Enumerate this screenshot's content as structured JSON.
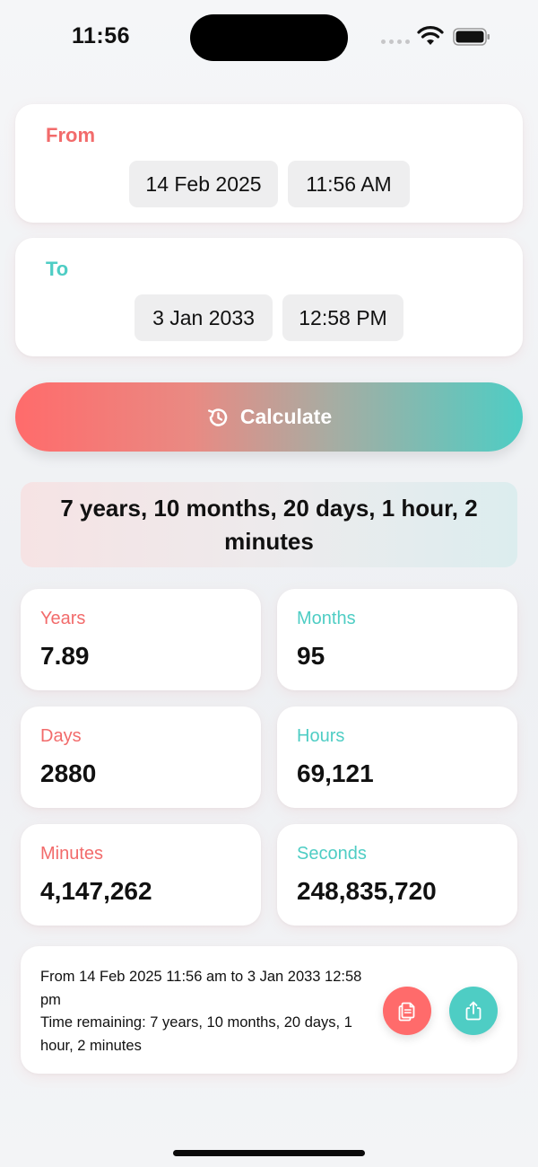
{
  "status_bar": {
    "time": "11:56"
  },
  "from": {
    "label": "From",
    "date": "14 Feb 2025",
    "time": "11:56 AM"
  },
  "to": {
    "label": "To",
    "date": "3 Jan 2033",
    "time": "12:58 PM"
  },
  "calculate_button": {
    "label": "Calculate",
    "icon": "history-icon"
  },
  "result": {
    "text": "7 years, 10 months, 20 days, 1 hour, 2 minutes"
  },
  "stats": [
    {
      "label": "Years",
      "value": "7.89"
    },
    {
      "label": "Months",
      "value": "95"
    },
    {
      "label": "Days",
      "value": "2880"
    },
    {
      "label": "Hours",
      "value": "69,121"
    },
    {
      "label": "Minutes",
      "value": "4,147,262"
    },
    {
      "label": "Seconds",
      "value": "248,835,720"
    }
  ],
  "summary": {
    "line1": "From 14 Feb 2025  11:56 am to 3 Jan 2033 12:58 pm",
    "line2": "Time remaining: 7 years, 10 months, 20 days, 1 hour, 2 minutes"
  },
  "actions": {
    "copy_icon": "copy-icon",
    "share_icon": "share-icon"
  },
  "colors": {
    "accent_coral": "#ff6b6b",
    "accent_teal": "#4ecdc4"
  }
}
